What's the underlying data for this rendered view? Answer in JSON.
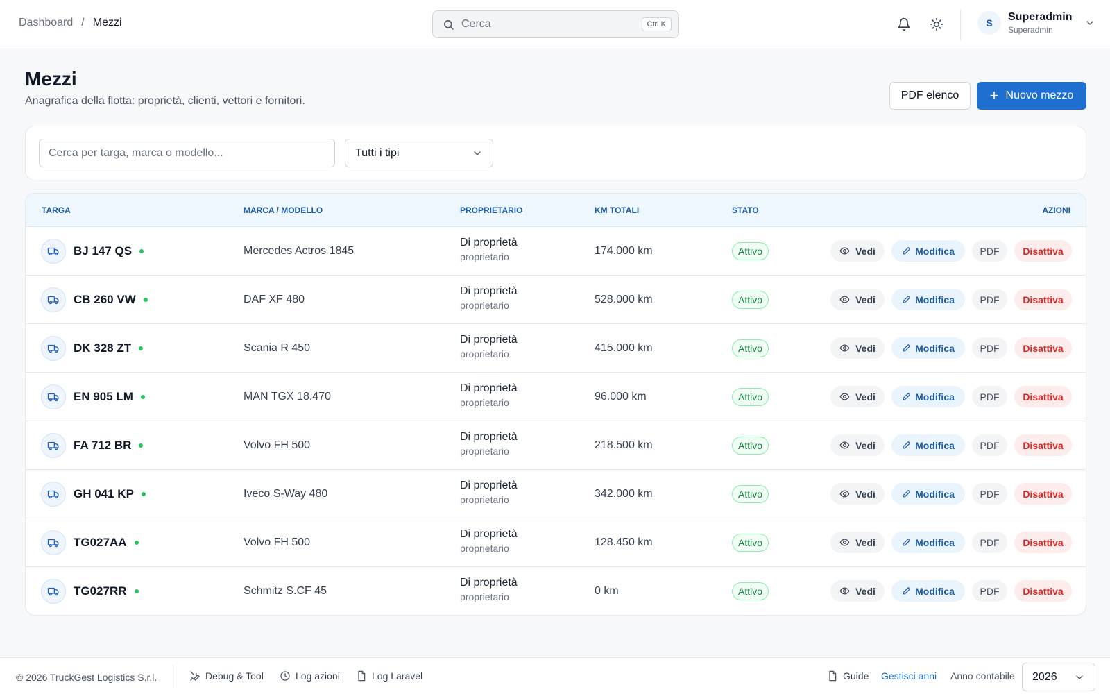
{
  "breadcrumb": {
    "home": "Dashboard",
    "separator": "/",
    "current": "Mezzi"
  },
  "topbar": {
    "search_placeholder": "Cerca",
    "shortcut": "Ctrl K",
    "user": {
      "initial": "S",
      "name": "Superadmin",
      "role": "Superadmin"
    },
    "icons": [
      "search-icon",
      "bell-icon",
      "sun-icon",
      "chevron-down-icon"
    ]
  },
  "page": {
    "title": "Mezzi",
    "subtitle": "Anagrafica della flotta: proprietà, clienti, vettori e fornitori.",
    "pdf_button": "PDF elenco",
    "new_button": "Nuovo mezzo"
  },
  "filters": {
    "search_placeholder": "Cerca per targa, marca o modello...",
    "type_select": "Tutti i tipi"
  },
  "table": {
    "columns": {
      "targa": "TARGA",
      "marca": "MARCA / MODELLO",
      "proprietario": "PROPRIETARIO",
      "km": "KM TOTALI",
      "stato": "STATO",
      "azioni": "AZIONI"
    },
    "actions": {
      "view": "Vedi",
      "edit": "Modifica",
      "pdf": "PDF",
      "deactivate": "Disattiva"
    },
    "rows": [
      {
        "plate": "BJ 147 QS",
        "model": "Mercedes Actros 1845",
        "owner": "Di proprietà",
        "owner_sub": "proprietario",
        "km": "174.000 km",
        "status": "Attivo"
      },
      {
        "plate": "CB 260 VW",
        "model": "DAF XF 480",
        "owner": "Di proprietà",
        "owner_sub": "proprietario",
        "km": "528.000 km",
        "status": "Attivo"
      },
      {
        "plate": "DK 328 ZT",
        "model": "Scania R 450",
        "owner": "Di proprietà",
        "owner_sub": "proprietario",
        "km": "415.000 km",
        "status": "Attivo"
      },
      {
        "plate": "EN 905 LM",
        "model": "MAN TGX 18.470",
        "owner": "Di proprietà",
        "owner_sub": "proprietario",
        "km": "96.000 km",
        "status": "Attivo"
      },
      {
        "plate": "FA 712 BR",
        "model": "Volvo FH 500",
        "owner": "Di proprietà",
        "owner_sub": "proprietario",
        "km": "218.500 km",
        "status": "Attivo"
      },
      {
        "plate": "GH 041 KP",
        "model": "Iveco S-Way 480",
        "owner": "Di proprietà",
        "owner_sub": "proprietario",
        "km": "342.000 km",
        "status": "Attivo"
      },
      {
        "plate": "TG027AA",
        "model": "Volvo FH 500",
        "owner": "Di proprietà",
        "owner_sub": "proprietario",
        "km": "128.450 km",
        "status": "Attivo"
      },
      {
        "plate": "TG027RR",
        "model": "Schmitz S.CF 45",
        "owner": "Di proprietà",
        "owner_sub": "proprietario",
        "km": "0 km",
        "status": "Attivo"
      }
    ]
  },
  "footer": {
    "copyright": "© 2026 TruckGest Logistics S.r.l.",
    "debug": "Debug & Tool",
    "log_actions": "Log azioni",
    "log_laravel": "Log Laravel",
    "guide": "Guide",
    "manage_years": "Gestisci anni",
    "year_label": "Anno contabile",
    "year_value": "2026"
  },
  "colors": {
    "accent": "#1e6fd0",
    "success": "#15803d",
    "danger": "#dc2626",
    "header_bg": "#eef7fd"
  }
}
